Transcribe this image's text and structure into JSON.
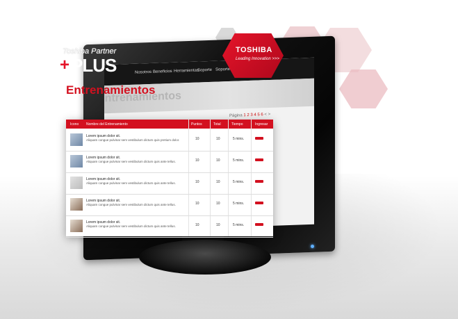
{
  "brand": {
    "program_partner": "Toshiba Partner",
    "program_plus_sign": "+",
    "program_plus": "PLUS",
    "company": "TOSHIBA",
    "tagline": "Leading Innovation >>>"
  },
  "page_title": "Entrenamientos",
  "screen": {
    "nav_items": [
      "Nosotros",
      "Beneficios",
      "Herramientas",
      "Soporte",
      "Soporte"
    ],
    "ghost_title": "Entrenamientos",
    "pager_label": "Página",
    "pager_numbers": "1 2 3 4 5 6",
    "pager_prev": "<",
    "pager_next": ">"
  },
  "table": {
    "headers": {
      "image": "Icono",
      "name": "Nombre del Entrenamiento",
      "points": "Puntos",
      "total": "Total",
      "time": "Tiempo",
      "go": "Ingresar"
    },
    "rows": [
      {
        "title": "Lorem ipsum dolor sit.",
        "desc": "Aliquam congue pulvinar sem vestibulum dictum quis pretium dolor.",
        "points": "10",
        "total": "10",
        "time": "5 mins."
      },
      {
        "title": "Lorem ipsum dolor sit.",
        "desc": "Aliquam congue pulvinar sem vestibulum dictum quis ante tellus.",
        "points": "10",
        "total": "10",
        "time": "5 mins."
      },
      {
        "title": "Lorem ipsum dolor sit.",
        "desc": "Aliquam congue pulvinar sem vestibulum dictum quis ante tellus.",
        "points": "10",
        "total": "10",
        "time": "5 mins."
      },
      {
        "title": "Lorem ipsum dolor sit.",
        "desc": "Aliquam congue pulvinar sem vestibulum dictum quis ante tellus.",
        "points": "10",
        "total": "10",
        "time": "5 mins."
      },
      {
        "title": "Lorem ipsum dolor sit.",
        "desc": "Aliquam congue pulvinar sem vestibulum dictum quis ante tellus.",
        "points": "10",
        "total": "10",
        "time": "5 mins."
      }
    ]
  },
  "colors": {
    "accent": "#d3101f",
    "monitor": "#0b0b0b",
    "hex_pink": "#f2c2c6",
    "hex_grey": "#d7d7d7"
  }
}
